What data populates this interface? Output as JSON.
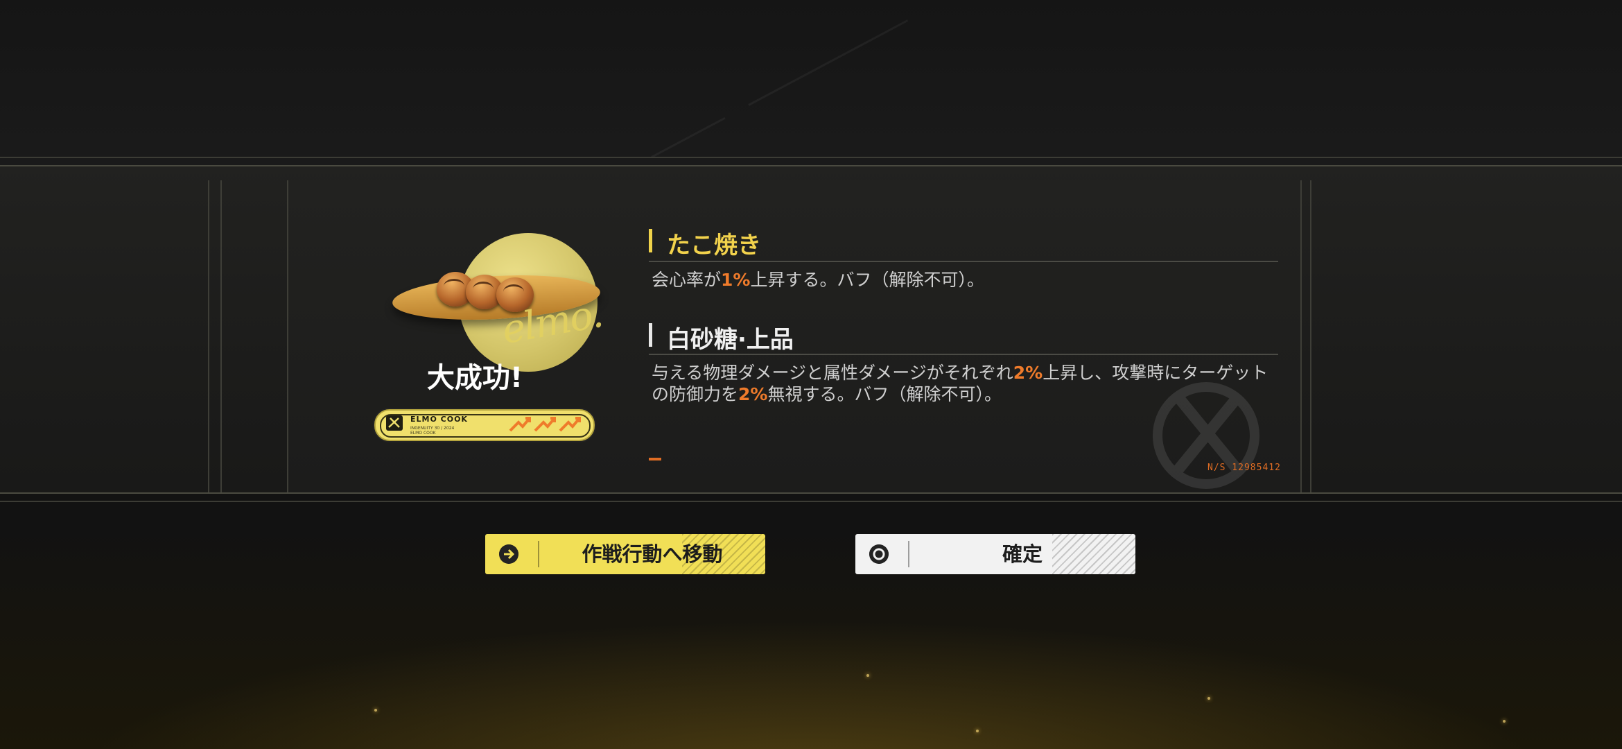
{
  "result": {
    "success_text": "大成功!",
    "script_signature": "elmo.",
    "badge": {
      "title": "ELMO COOK",
      "subtitle": "INGENUITY 30 / 2024 ELMO COOK"
    }
  },
  "item": {
    "name": "たこ焼き",
    "effect_before": "会心率が",
    "effect_value": "1%",
    "effect_after": "上昇する。バフ（解除不可）。"
  },
  "ingredient": {
    "name": "白砂糖·上品",
    "effect_part1": "与える物理ダメージと属性ダメージがそれぞれ",
    "effect_value1": "2%",
    "effect_part2": "上昇し、攻撃時にターゲットの防御力を",
    "effect_value2": "2%",
    "effect_part3": "無視する。バフ（解除不可）。"
  },
  "serial": "N/S 12985412",
  "buttons": {
    "move_label": "作戦行動へ移動",
    "confirm_label": "確定"
  },
  "colors": {
    "accent_yellow": "#f1df56",
    "highlight_orange": "#ef7b2b",
    "confirm_white": "#f2f2f2"
  },
  "icons": {
    "move_button": "arrow-circle-right-icon",
    "confirm_button": "circle-dot-icon",
    "badge": "elmo-cook-logo-icon",
    "watermark": "crossed-utensils-icon"
  }
}
